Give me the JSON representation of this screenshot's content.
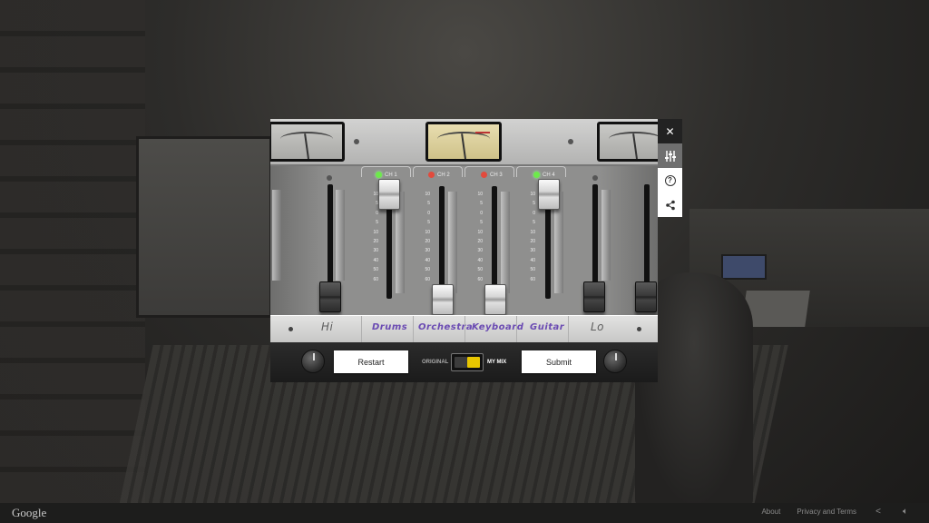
{
  "channels": [
    {
      "id": "CH 1",
      "label": "Drums",
      "led": "on",
      "level": 0.87
    },
    {
      "id": "CH 2",
      "label": "Orchestra",
      "led": "off",
      "level": 0.08
    },
    {
      "id": "CH 3",
      "label": "Keyboard",
      "led": "off",
      "level": 0.08
    },
    {
      "id": "CH 4",
      "label": "Guitar",
      "led": "on",
      "level": 0.87
    }
  ],
  "side_labels": {
    "hi": "Hi",
    "lo": "Lo"
  },
  "scale_ticks": [
    "10",
    "5",
    "0",
    "5",
    "10",
    "20",
    "30",
    "40",
    "50",
    "60"
  ],
  "controls": {
    "restart_label": "Restart",
    "submit_label": "Submit",
    "toggle_left": "ORIGINAL",
    "toggle_right": "MY MIX",
    "toggle_state": "MY MIX"
  },
  "toolbar": {
    "close_icon": "close-icon",
    "mixer_icon": "sliders-icon",
    "help_icon": "help-icon",
    "share_icon": "share-icon"
  },
  "footer": {
    "brand": "Google",
    "about": "About",
    "privacy": "Privacy and Terms"
  },
  "colors": {
    "label_purple": "#6b4bb3",
    "led_green": "#6dea4a",
    "led_red": "#e24a3c",
    "toggle_yellow": "#e8c600"
  }
}
